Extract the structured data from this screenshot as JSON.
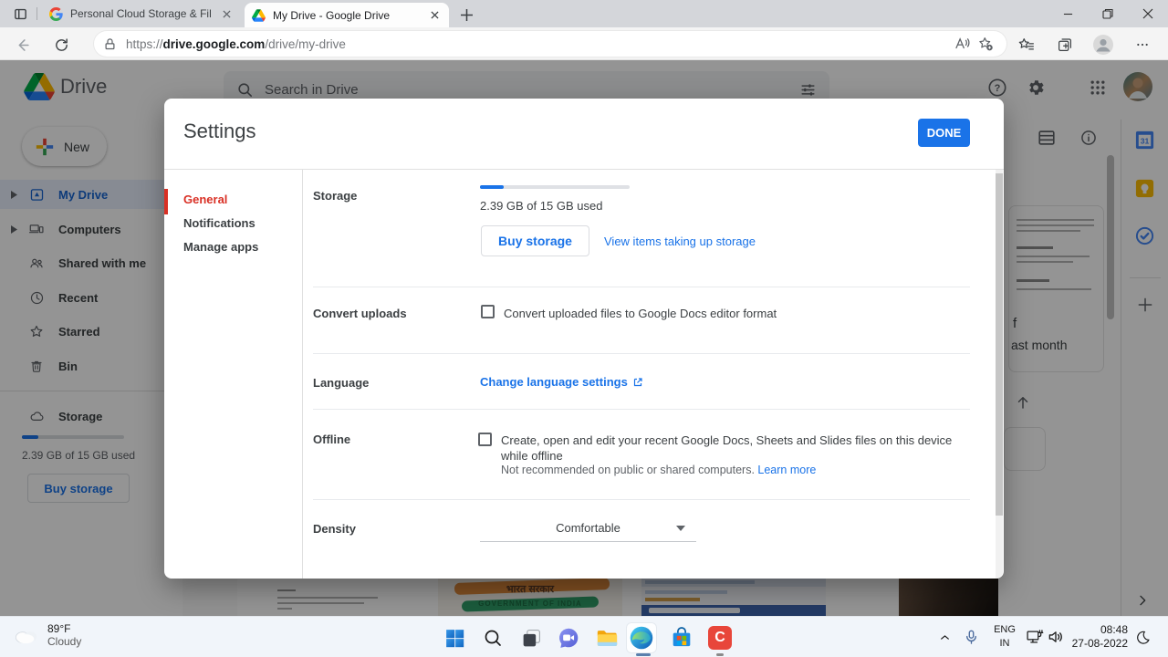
{
  "window": {
    "tabs": [
      {
        "title": "Personal Cloud Storage & File Sh",
        "favicon": "google-g",
        "active": false
      },
      {
        "title": "My Drive - Google Drive",
        "favicon": "drive-triangle",
        "active": true
      }
    ],
    "address": {
      "scheme": "https://",
      "domain": "drive.google.com",
      "path": "/drive/my-drive"
    }
  },
  "drive": {
    "logo": "Drive",
    "search": {
      "placeholder": "Search in Drive"
    },
    "new_button": "New",
    "sidebar": {
      "items": [
        {
          "label": "My Drive",
          "selected": true
        },
        {
          "label": "Computers",
          "selected": false
        },
        {
          "label": "Shared with me",
          "selected": false
        },
        {
          "label": "Recent",
          "selected": false
        },
        {
          "label": "Starred",
          "selected": false
        },
        {
          "label": "Bin",
          "selected": false
        }
      ],
      "storage": {
        "label": "Storage",
        "usage": "2.39 GB of 15 GB used",
        "buy_button": "Buy storage",
        "used_percent": 16
      }
    },
    "background": {
      "fragment_top": "f",
      "fragment_bottom": "ast month",
      "flag_line1": "भारत सरकार",
      "flag_line2": "GOVERNMENT OF INDIA"
    }
  },
  "settings_dialog": {
    "title": "Settings",
    "done_button": "DONE",
    "nav": [
      {
        "label": "General",
        "selected": true
      },
      {
        "label": "Notifications",
        "selected": false
      },
      {
        "label": "Manage apps",
        "selected": false
      }
    ],
    "storage": {
      "label": "Storage",
      "usage": "2.39 GB of 15 GB used",
      "used_percent": 16,
      "buy_button": "Buy storage",
      "view_link": "View items taking up storage"
    },
    "convert": {
      "label": "Convert uploads",
      "option": "Convert uploaded files to Google Docs editor format",
      "checked": false
    },
    "language": {
      "label": "Language",
      "link": "Change language settings"
    },
    "offline": {
      "label": "Offline",
      "option": "Create, open and edit your recent Google Docs, Sheets and Slides files on this device while offline",
      "note": "Not recommended on public or shared computers.",
      "learn_more": "Learn more",
      "checked": false
    },
    "density": {
      "label": "Density",
      "value": "Comfortable"
    }
  },
  "taskbar": {
    "weather": {
      "temperature": "89°F",
      "condition": "Cloudy"
    },
    "tray": {
      "language": "ENG",
      "region": "IN",
      "time": "08:48",
      "date": "27-08-2022"
    }
  },
  "colors": {
    "accent_blue": "#1a73e8",
    "selected_nav_red": "#d93025",
    "drive_selected_row": "#e8f0fe",
    "taskbar_bg": "#f1f5fa"
  }
}
